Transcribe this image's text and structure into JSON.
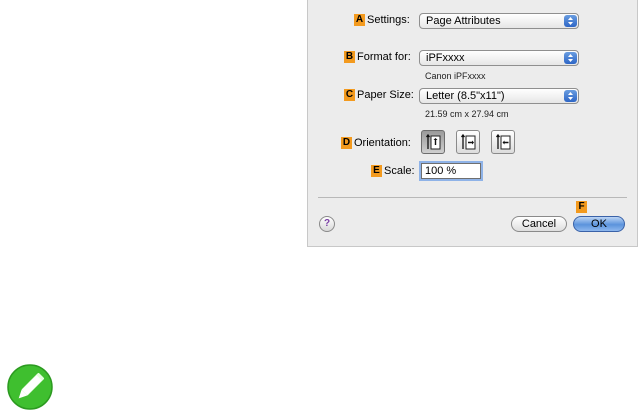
{
  "dialog": {
    "settings": {
      "marker": "A",
      "label": "Settings:",
      "value": "Page Attributes"
    },
    "format_for": {
      "marker": "B",
      "label": "Format for:",
      "value": "iPFxxxx",
      "subtext": "Canon iPFxxxx"
    },
    "paper_size": {
      "marker": "C",
      "label": "Paper Size:",
      "value": "Letter (8.5\"x11\")",
      "subtext": "21.59 cm x 27.94 cm"
    },
    "orientation": {
      "marker": "D",
      "label": "Orientation:",
      "options": [
        "portrait",
        "landscape-left",
        "landscape-right"
      ],
      "selected": "portrait"
    },
    "scale": {
      "marker": "E",
      "label": "Scale:",
      "value": "100 %"
    },
    "buttons": {
      "help": "?",
      "cancel": "Cancel",
      "ok_marker": "F",
      "ok": "OK"
    }
  },
  "colors": {
    "marker": "#f39a1e",
    "accent": "#5b93dc",
    "note_icon": "#3fbf2f"
  },
  "icons": {
    "note": "pencil-note-icon"
  }
}
